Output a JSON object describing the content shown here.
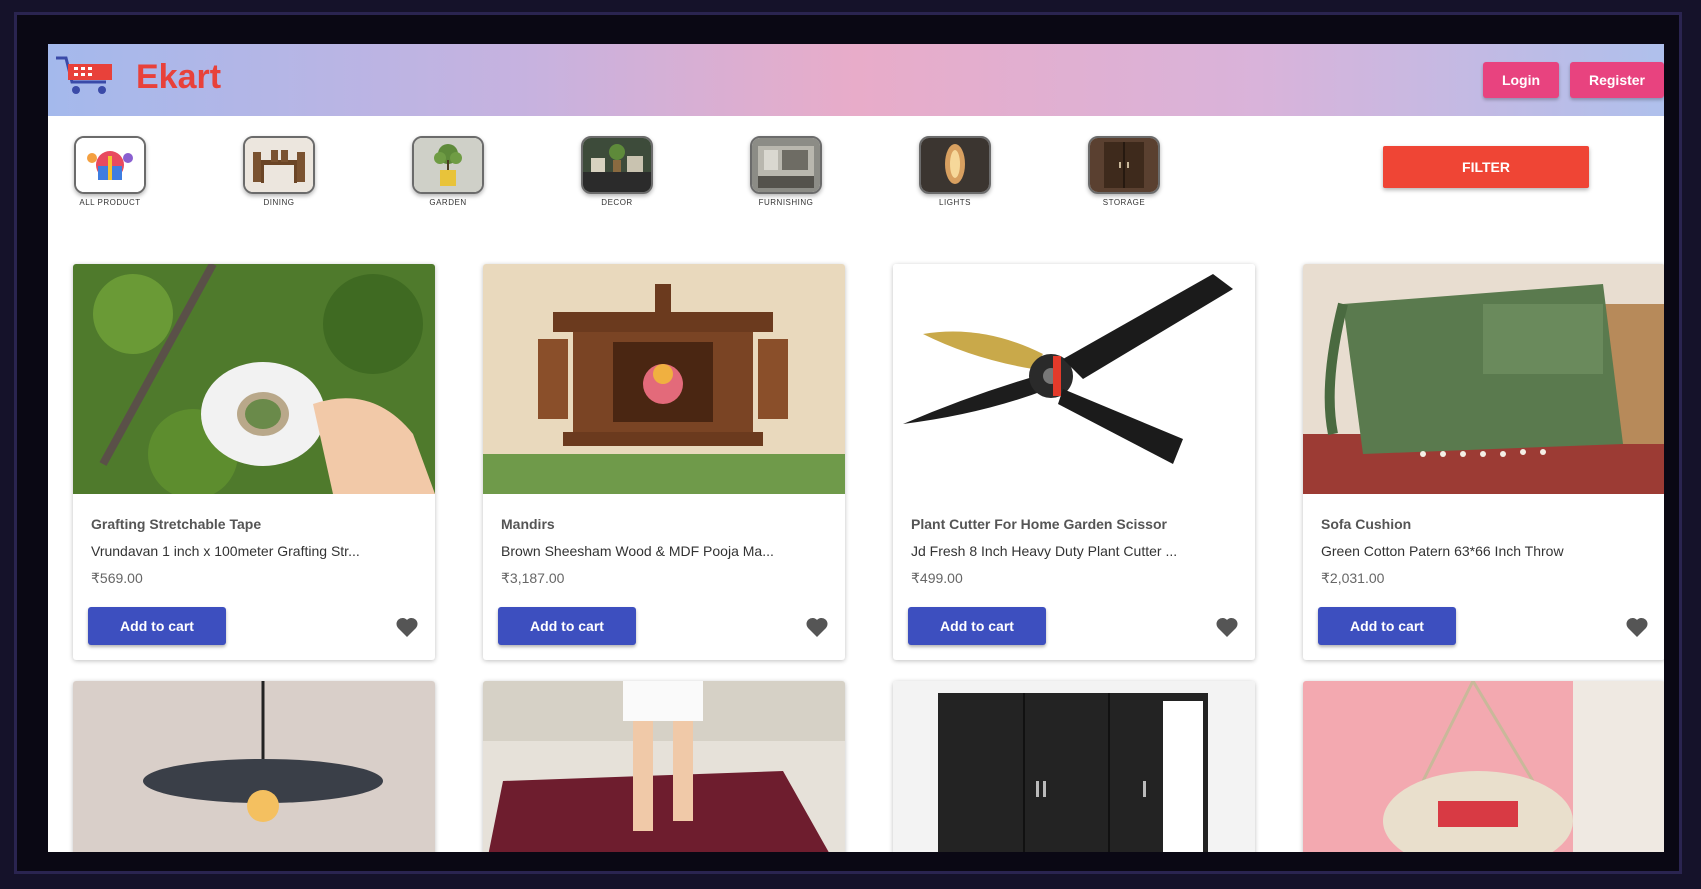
{
  "brand": {
    "name": "Ekart",
    "accent": "#e8413a"
  },
  "header": {
    "login_label": "Login",
    "register_label": "Register",
    "button_color": "#e8437f"
  },
  "categories": [
    {
      "label": "ALL PRODUCT",
      "icon": "gift-icon"
    },
    {
      "label": "DINING",
      "icon": "dining-set-icon"
    },
    {
      "label": "GARDEN",
      "icon": "plant-pot-icon"
    },
    {
      "label": "DECOR",
      "icon": "decor-icon"
    },
    {
      "label": "FURNISHING",
      "icon": "furnishing-icon"
    },
    {
      "label": "LIGHTS",
      "icon": "lamp-icon"
    },
    {
      "label": "STORAGE",
      "icon": "wardrobe-icon"
    }
  ],
  "filter": {
    "label": "FILTER",
    "color": "#ef4535"
  },
  "products": [
    {
      "title": "Grafting Stretchable Tape",
      "desc": "Vrundavan 1 inch x 100meter Grafting Str...",
      "price": "₹569.00",
      "cart_label": "Add to cart",
      "image": "tape-roll-image"
    },
    {
      "title": "Mandirs",
      "desc": "Brown Sheesham Wood & MDF Pooja Ma...",
      "price": "₹3,187.00",
      "cart_label": "Add to cart",
      "image": "wooden-mandir-image"
    },
    {
      "title": "Plant Cutter For Home Garden Scissor",
      "desc": "Jd Fresh 8 Inch Heavy Duty Plant Cutter ...",
      "price": "₹499.00",
      "cart_label": "Add to cart",
      "image": "pruning-shears-image"
    },
    {
      "title": "Sofa Cushion",
      "desc": "Green Cotton Patern 63*66 Inch Throw",
      "price": "₹2,031.00",
      "cart_label": "Add to cart",
      "image": "green-throw-image"
    }
  ],
  "products_row2": [
    {
      "image": "pendant-lamp-image"
    },
    {
      "image": "bath-mat-image"
    },
    {
      "image": "black-wardrobe-image"
    },
    {
      "image": "hanging-swing-chair-image"
    }
  ],
  "colors": {
    "cart_button": "#3d4fbf",
    "heart": "#555555"
  }
}
